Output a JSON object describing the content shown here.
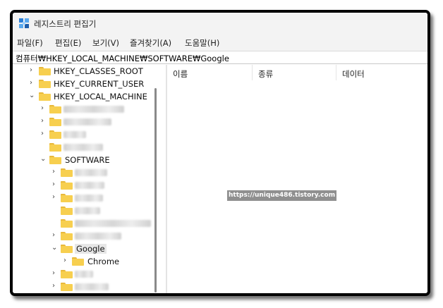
{
  "window": {
    "title": "레지스트리 편집기",
    "app_icon": "registry-editor-icon"
  },
  "menu": [
    "파일(F)",
    "편집(E)",
    "보기(V)",
    "즐겨찾기(A)",
    "도움말(H)"
  ],
  "address": "컴퓨터₩HKEY_LOCAL_MACHINE₩SOFTWARE₩Google",
  "tree": {
    "hkcr": "HKEY_CLASSES_ROOT",
    "hkcu": "HKEY_CURRENT_USER",
    "hklm": "HKEY_LOCAL_MACHINE",
    "software": "SOFTWARE",
    "google": "Google",
    "chrome": "Chrome"
  },
  "columns": [
    "이름",
    "종류",
    "데이터"
  ],
  "watermark": "https://unique486.tistory.com"
}
